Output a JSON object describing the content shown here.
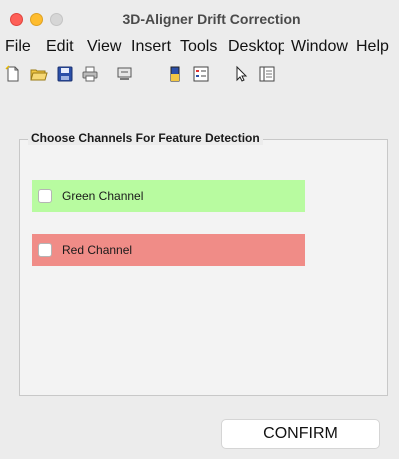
{
  "window": {
    "title": "3D-Aligner Drift Correction"
  },
  "menubar": {
    "items": [
      "File",
      "Edit",
      "View",
      "Insert",
      "Tools",
      "Desktop",
      "Window",
      "Help"
    ]
  },
  "toolbar": {
    "icons": [
      "new-figure-icon",
      "open-file-icon",
      "save-icon",
      "print-icon",
      "link-icon",
      "colorbar-icon",
      "legend-icon",
      "pointer-icon",
      "property-editor-icon"
    ]
  },
  "panel": {
    "title": "Choose Channels For Feature Detection",
    "channels": [
      {
        "label": "Green Channel",
        "checked": false,
        "color": "#b8fba0"
      },
      {
        "label": "Red Channel",
        "checked": false,
        "color": "#f08c87"
      }
    ]
  },
  "confirm_button": {
    "label": "CONFIRM"
  }
}
